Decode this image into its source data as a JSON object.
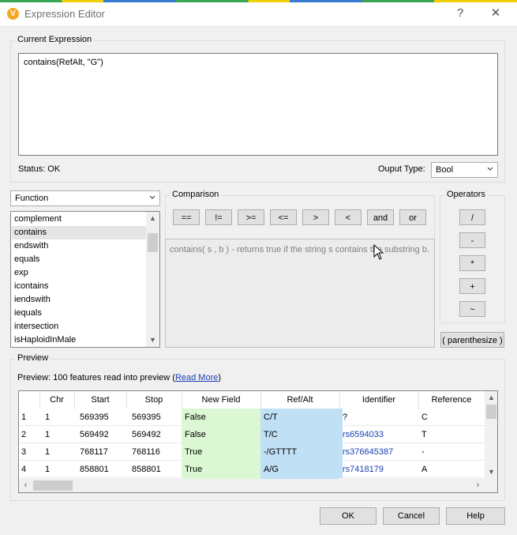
{
  "window": {
    "title": "Expression Editor",
    "help_glyph": "?",
    "close_glyph": "✕",
    "app_icon_letter": "V"
  },
  "current_expression": {
    "label": "Current Expression",
    "value": "contains(RefAlt, \"G\")"
  },
  "status": {
    "text": "Status: OK"
  },
  "output_type": {
    "label": "Ouput Type:",
    "value": "Bool"
  },
  "function_select": {
    "value": "Function"
  },
  "function_list": {
    "items": [
      "complement",
      "contains",
      "endswith",
      "equals",
      "exp",
      "icontains",
      "iendswith",
      "iequals",
      "intersection",
      "isHaploidInMale"
    ],
    "selected": "contains"
  },
  "comparison": {
    "label": "Comparison",
    "buttons": [
      "==",
      "!=",
      ">=",
      "<=",
      ">",
      "<",
      "and",
      "or"
    ]
  },
  "description": {
    "text": "contains( s , b ) - returns true if the string s contains the substring b."
  },
  "operators": {
    "label": "Operators",
    "buttons": [
      "/",
      "-",
      "*",
      "+",
      "~"
    ]
  },
  "parenthesize": {
    "label": "( parenthesize )"
  },
  "preview": {
    "label": "Preview",
    "info_prefix": "Preview: 100 features read into preview (",
    "read_more": "Read More",
    "info_suffix": ")",
    "columns": [
      "",
      "Chr",
      "Start",
      "Stop",
      "New Field",
      "Ref/Alt",
      "Identifier",
      "Reference"
    ],
    "rows": [
      {
        "n": "1",
        "chr": "1",
        "start": "569395",
        "stop": "569395",
        "new_field": "False",
        "refalt": "C/T",
        "identifier": "?",
        "reference": "C",
        "id_link": false
      },
      {
        "n": "2",
        "chr": "1",
        "start": "569492",
        "stop": "569492",
        "new_field": "False",
        "refalt": "T/C",
        "identifier": "rs6594033",
        "reference": "T",
        "id_link": true
      },
      {
        "n": "3",
        "chr": "1",
        "start": "768117",
        "stop": "768116",
        "new_field": "True",
        "refalt": "-/GTTTT",
        "identifier": "rs376645387",
        "reference": "-",
        "id_link": true
      },
      {
        "n": "4",
        "chr": "1",
        "start": "858801",
        "stop": "858801",
        "new_field": "True",
        "refalt": "A/G",
        "identifier": "rs7418179",
        "reference": "A",
        "id_link": true
      }
    ]
  },
  "footer": {
    "ok": "OK",
    "cancel": "Cancel",
    "help": "Help"
  },
  "colors": {
    "new_field_bg": "#dcf7d4",
    "refalt_bg": "#bfe0f5",
    "link": "#1a3fb3",
    "app_icon": "#f5a623"
  }
}
